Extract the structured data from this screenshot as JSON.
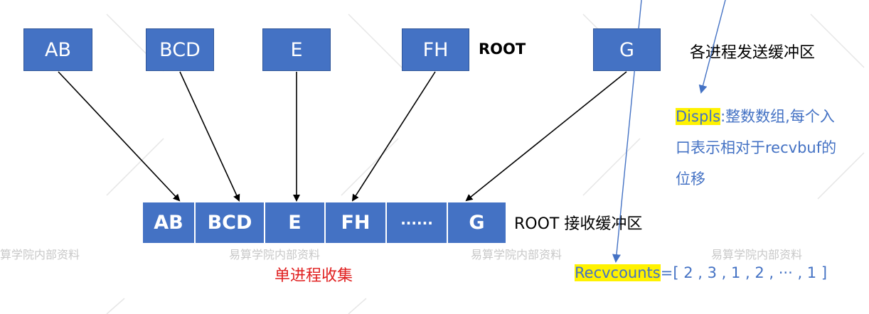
{
  "send_buffers": [
    "AB",
    "BCD",
    "E",
    "FH",
    "G"
  ],
  "root_tag": "ROOT",
  "send_caption": "各进程发送缓冲区",
  "recv_cells": [
    "AB",
    "BCD",
    "E",
    "FH",
    "······",
    "G"
  ],
  "recv_caption": "ROOT 接收缓冲区",
  "gather_caption": "单进程收集",
  "displs": {
    "keyword": "Displs",
    "line1": ":整数数组,每个入",
    "line2": "口表示相对于recvbuf的",
    "line3": "位移"
  },
  "recvcounts": {
    "keyword": "Recvcounts",
    "rest": "=[ 2 , 3 , 1 , 2 , ··· , 1 ]"
  },
  "watermark": [
    "算学院内部资料",
    "易算学院内部资料",
    "易算学院内部资料",
    "易算学院内部资料"
  ],
  "colors": {
    "box": "#4472c4",
    "caption_red": "#e02020",
    "text_blue": "#4472c4",
    "highlight": "#fff200"
  }
}
